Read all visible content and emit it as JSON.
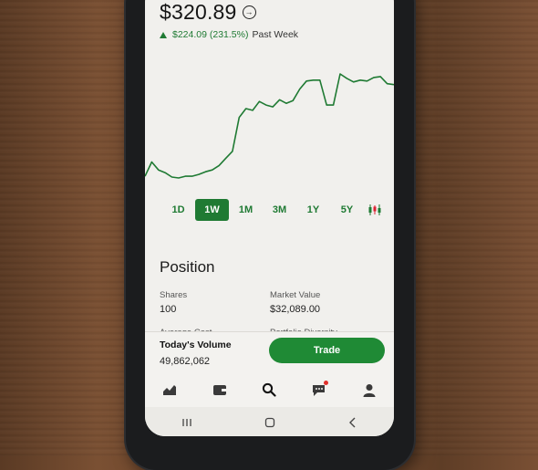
{
  "stock": {
    "price": "$320.89",
    "change": "$224.09 (231.5%)",
    "period": "Past Week"
  },
  "chart_data": {
    "type": "line",
    "series": [
      {
        "values": [
          10,
          26,
          17,
          14,
          9,
          8,
          10,
          10,
          12,
          15,
          17,
          22,
          30,
          38,
          76,
          86,
          84,
          94,
          90,
          88,
          96,
          92,
          95,
          108,
          117,
          118,
          118,
          90,
          90,
          125,
          120,
          116,
          118,
          117,
          121,
          122,
          114,
          113
        ]
      }
    ]
  },
  "ranges": [
    "1D",
    "1W",
    "1M",
    "3M",
    "1Y",
    "5Y"
  ],
  "active_range": "1W",
  "position": {
    "title": "Position",
    "shares_label": "Shares",
    "shares_value": "100",
    "market_value_label": "Market Value",
    "market_value_value": "$32,089.00",
    "avg_cost_label": "Average Cost",
    "diversity_label": "Portfolio Diversity"
  },
  "volume": {
    "label": "Today's Volume",
    "value": "49,862,062"
  },
  "trade_button": "Trade",
  "nav_icons": [
    "chart-icon",
    "wallet-icon",
    "search-icon",
    "messages-icon",
    "account-icon"
  ],
  "colors": {
    "accent": "#1f7a33",
    "button": "#1f8a35",
    "notification": "#e0302b"
  }
}
